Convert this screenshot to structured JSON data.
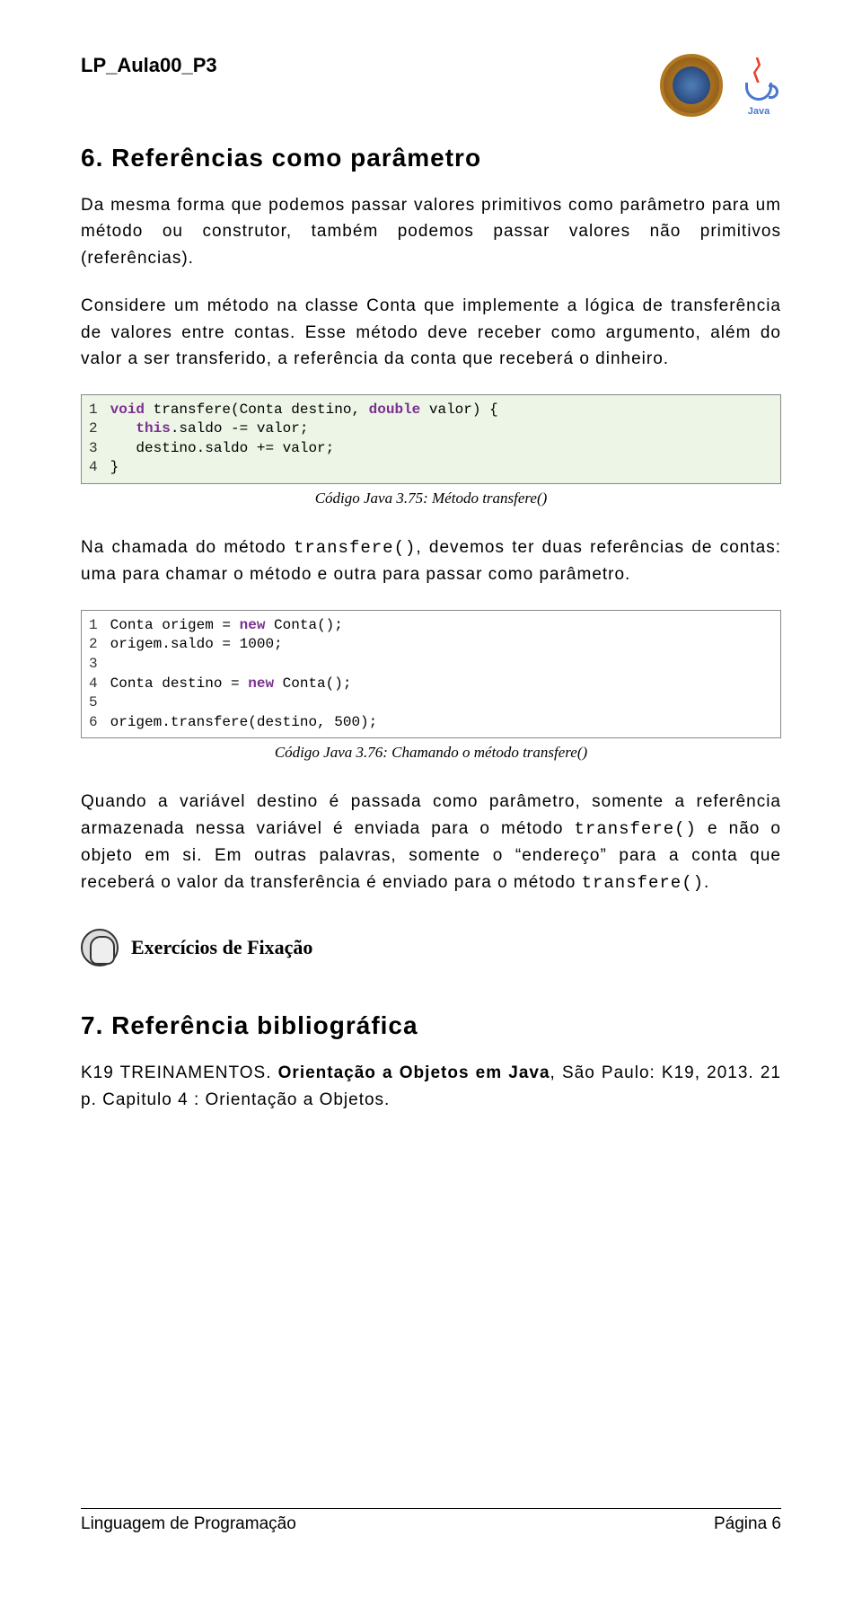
{
  "header": {
    "doc_id": "LP_Aula00_P3",
    "java_label": "Java"
  },
  "section6": {
    "heading": "6. Referências como parâmetro",
    "p1": "Da mesma forma que podemos passar valores primitivos como parâmetro para um método ou construtor, também podemos passar valores não primitivos (referências).",
    "p2": "Considere um método na classe Conta que implemente a lógica de transferência de valores entre contas. Esse método deve receber como argumento, além do valor a ser transferido, a referência da conta que receberá o dinheiro."
  },
  "code1": {
    "lines": "1\n2\n3\n4",
    "text_l1_a": "void",
    "text_l1_b": " transfere(Conta destino, ",
    "text_l1_c": "double",
    "text_l1_d": " valor) {",
    "text_l2_a": "   ",
    "text_l2_b": "this",
    "text_l2_c": ".saldo -= valor;",
    "text_l3": "   destino.saldo += valor;",
    "text_l4": "}",
    "caption": "Código Java 3.75: Método transfere()"
  },
  "section6b": {
    "p3a": "Na chamada do método ",
    "p3code": "transfere()",
    "p3b": ", devemos ter duas referências de contas: uma para chamar o método e outra para passar como parâmetro."
  },
  "code2": {
    "lines": "1\n2\n3\n4\n5\n6",
    "l1a": "Conta origem = ",
    "l1b": "new",
    "l1c": " Conta();",
    "l2": "origem.saldo = 1000;",
    "l3": "",
    "l4a": "Conta destino = ",
    "l4b": "new",
    "l4c": " Conta();",
    "l5": "",
    "l6": "origem.transfere(destino, 500);",
    "caption": "Código Java 3.76: Chamando o método transfere()"
  },
  "section6c": {
    "p4a": "Quando a variável destino é passada como parâmetro, somente a referência armazenada nessa variável é enviada para o método ",
    "p4code1": "transfere()",
    "p4b": " e não o objeto em si. Em outras palavras, somente o “endereço” para a conta que receberá o valor da transferência é enviado para o método ",
    "p4code2": "transfere()",
    "p4c": "."
  },
  "exercise_label": "Exercícios de Fixação",
  "section7": {
    "heading": "7. Referência bibliográfica",
    "bib_a": "K19 TREINAMENTOS. ",
    "bib_b": "Orientação a Objetos em Java",
    "bib_c": ", São Paulo: K19, 2013. 21 p. Capitulo 4 : Orientação a Objetos."
  },
  "footer": {
    "left": "Linguagem de Programação",
    "right": "Página 6"
  }
}
